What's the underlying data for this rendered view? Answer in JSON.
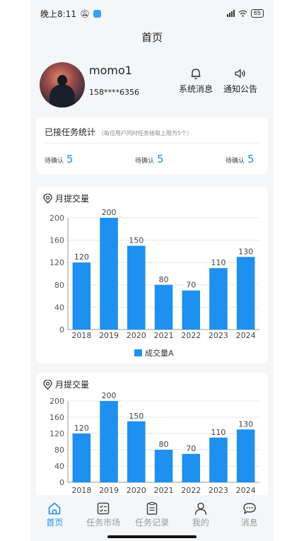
{
  "status_bar": {
    "time": "晚上8:11",
    "battery": "65"
  },
  "header": {
    "title": "首页"
  },
  "profile": {
    "username": "momo1",
    "phone": "158****6356",
    "system_msg": "系统消息",
    "notice": "通知公告"
  },
  "stats": {
    "title": "已接任务统计",
    "note": "（每位用户同时任务接取上限为5个）",
    "items": [
      {
        "label": "待确认",
        "value": "5"
      },
      {
        "label": "待确认",
        "value": "5"
      },
      {
        "label": "待确认",
        "value": "5"
      }
    ]
  },
  "charts": [
    {
      "title": "月提交量"
    },
    {
      "title": "月提交量"
    }
  ],
  "chart_data": [
    {
      "type": "bar",
      "categories": [
        "2018",
        "2019",
        "2020",
        "2021",
        "2022",
        "2023",
        "2024"
      ],
      "series": [
        {
          "name": "成交量A",
          "values": [
            120,
            200,
            150,
            80,
            70,
            110,
            130
          ]
        }
      ],
      "ylim": [
        0,
        200
      ],
      "yticks": [
        0,
        40,
        80,
        120,
        160,
        200
      ],
      "color": "#1e90f0",
      "legend_position": "bottom-center",
      "grid": true
    },
    {
      "type": "bar",
      "categories": [
        "2018",
        "2019",
        "2020",
        "2021",
        "2022",
        "2023",
        "2024"
      ],
      "series": [
        {
          "values": [
            120,
            200,
            150,
            80,
            70,
            110,
            130
          ]
        }
      ],
      "ylim": [
        0,
        200
      ],
      "yticks": [
        0,
        40,
        80,
        120,
        160,
        200
      ],
      "color": "#1e90f0",
      "grid": true
    }
  ],
  "tabs": [
    {
      "label": "首页",
      "icon": "home-icon",
      "active": true
    },
    {
      "label": "任务市场",
      "icon": "market-icon",
      "active": false
    },
    {
      "label": "任务记录",
      "icon": "record-icon",
      "active": false
    },
    {
      "label": "我的",
      "icon": "user-icon",
      "active": false
    },
    {
      "label": "消息",
      "icon": "message-icon",
      "active": false
    }
  ]
}
